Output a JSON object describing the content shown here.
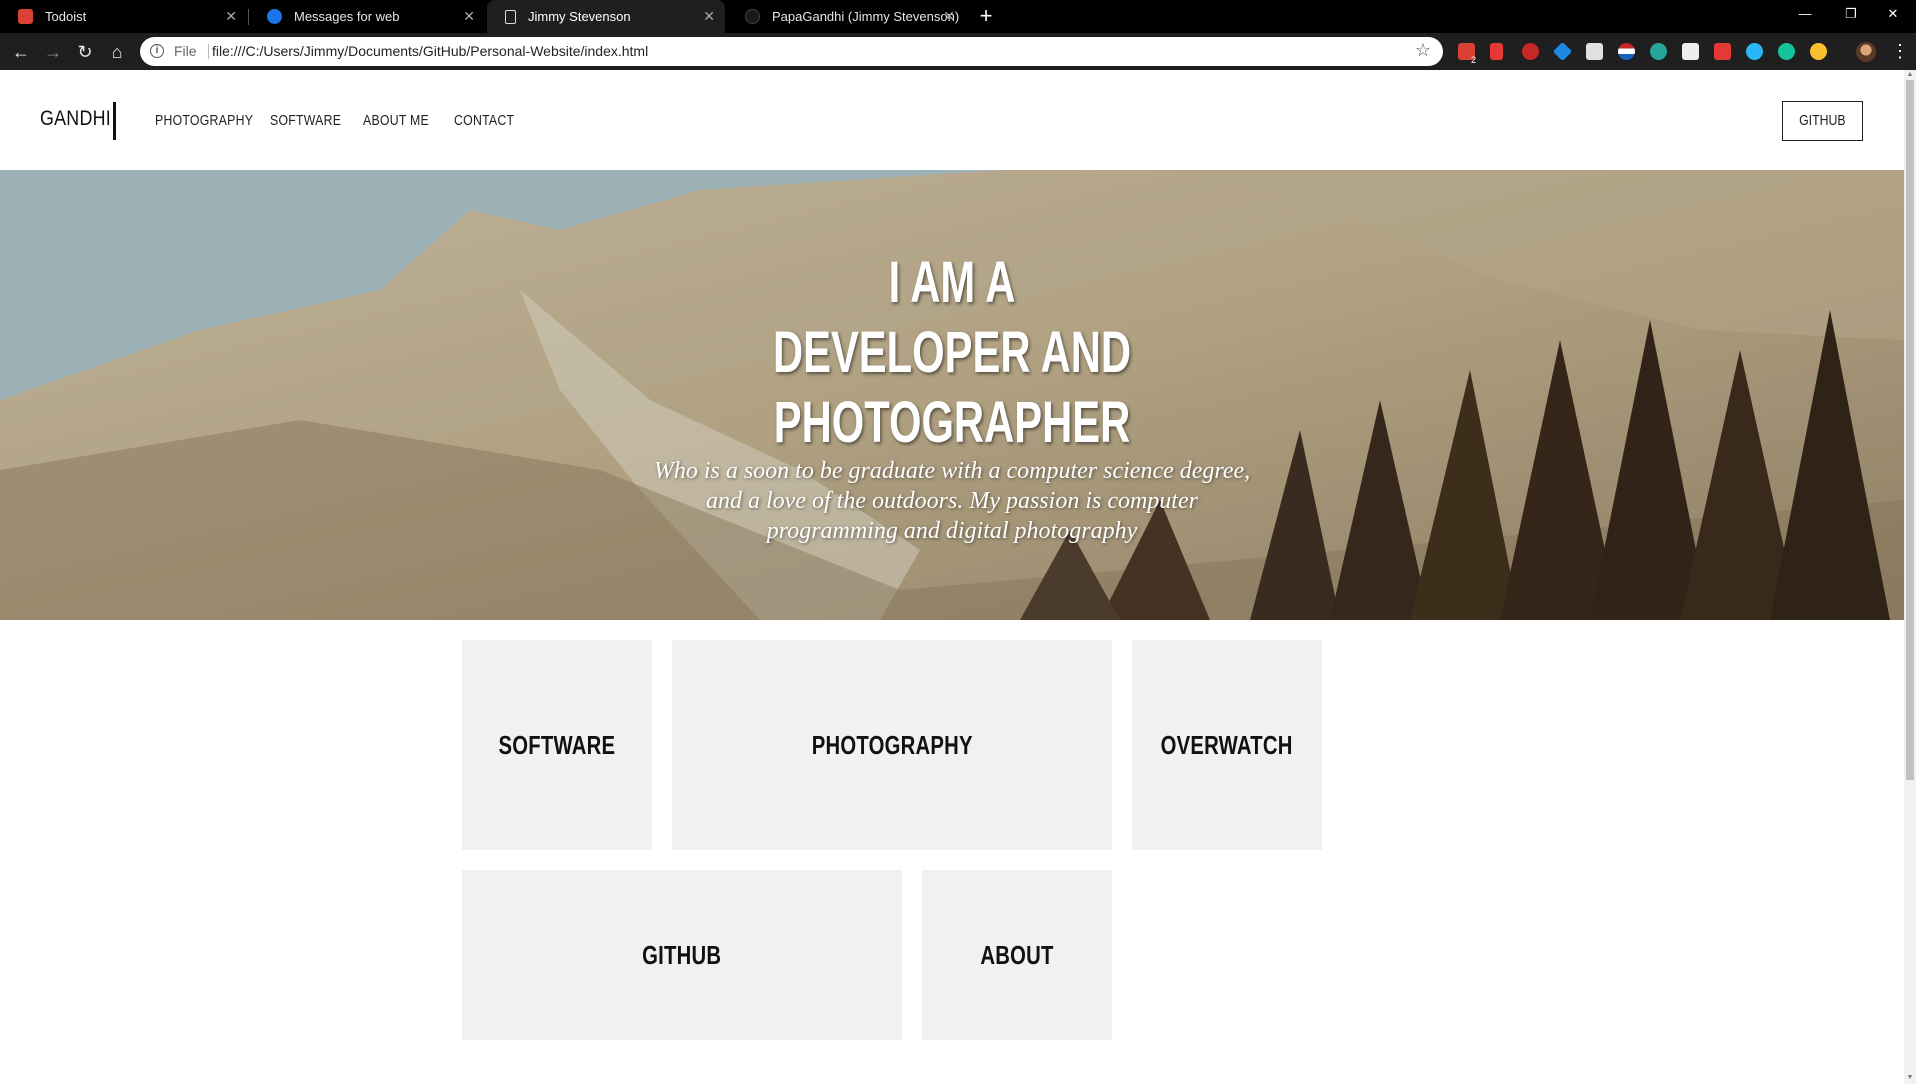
{
  "browser": {
    "tabs": [
      {
        "title": "Todoist",
        "favicon": "todoist-icon",
        "color": "#db4035",
        "active": false
      },
      {
        "title": "Messages for web",
        "favicon": "messages-icon",
        "color": "#1a73e8",
        "active": false
      },
      {
        "title": "Jimmy Stevenson",
        "favicon": "page-icon",
        "color": "#ffffff",
        "active": true
      },
      {
        "title": "PapaGandhi (Jimmy Stevenson)",
        "favicon": "github-icon",
        "color": "#333333",
        "active": false
      }
    ],
    "url_scheme_label": "File",
    "url": "file:///C:/Users/Jimmy/Documents/GitHub/Personal-Website/index.html",
    "extension_badge": "2"
  },
  "site": {
    "brand": "GANDHI",
    "nav": [
      "PHOTOGRAPHY",
      "SOFTWARE",
      "ABOUT ME",
      "CONTACT"
    ],
    "github_button": "GITHUB",
    "hero": {
      "title_lines": [
        "I AM A",
        "DEVELOPER AND",
        "PHOTOGRAPHER"
      ],
      "subtitle": "Who is a soon to be graduate with a computer science degree, and a love of the outdoors. My passion is computer programming and digital photography"
    },
    "tiles": [
      "SOFTWARE",
      "PHOTOGRAPHY",
      "OVERWATCH",
      "GITHUB",
      "ABOUT"
    ]
  }
}
